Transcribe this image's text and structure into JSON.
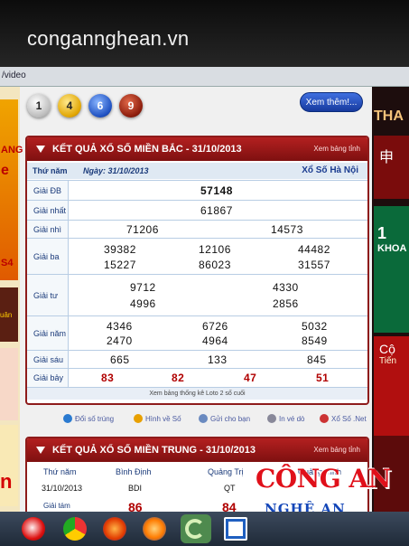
{
  "watermark": "congannghean.vn",
  "browser": {
    "tab_label": "/video"
  },
  "balls": [
    "1",
    "4",
    "6",
    "9"
  ],
  "more_button": "Xem thêm!...",
  "north": {
    "title": "KẾT QUẢ XỔ SỐ MIỀN BẮC - 31/10/2013",
    "view_by_province": "Xem bảng tỉnh",
    "col_header_thu_nam": "Thứ năm",
    "date_label": "Ngày: 31/10/2013",
    "lottery_name": "Xổ Số Hà Nội",
    "prizes": [
      {
        "label": "Giải ĐB",
        "numbers": [
          "57148"
        ]
      },
      {
        "label": "Giải nhất",
        "numbers": [
          "61867"
        ]
      },
      {
        "label": "Giải nhì",
        "numbers": [
          "71206",
          "14573"
        ]
      },
      {
        "label": "Giải ba",
        "numbers": [
          "39382",
          "12106",
          "44482",
          "15227",
          "86023",
          "31557"
        ]
      },
      {
        "label": "Giải tư",
        "numbers": [
          "9712",
          "4330",
          "4996",
          "2856"
        ]
      },
      {
        "label": "Giải năm",
        "numbers": [
          "4346",
          "6726",
          "5032",
          "2470",
          "4964",
          "8549"
        ]
      },
      {
        "label": "Giải sáu",
        "numbers": [
          "665",
          "133",
          "845"
        ]
      },
      {
        "label": "Giải bảy",
        "numbers": [
          "83",
          "82",
          "47",
          "51"
        ]
      }
    ],
    "footnote": "Xem bảng thống kê Loto 2 số cuối"
  },
  "links": [
    {
      "label": "Đổi số trúng",
      "icon": "globe-icon"
    },
    {
      "label": "Hình về Số",
      "icon": "dollar-icon"
    },
    {
      "label": "Gửi cho bạn",
      "icon": "mail-icon"
    },
    {
      "label": "In vé dò",
      "icon": "print-icon"
    },
    {
      "label": "Xổ Số .Net",
      "icon": "lottery-icon"
    }
  ],
  "central": {
    "title": "KẾT QUẢ XỔ SỐ MIỀN TRUNG - 31/10/2013",
    "view_by_province": "Xem bảng tỉnh",
    "col_header": "Thứ năm",
    "provinces": [
      "Bình Định",
      "Quảng Trị",
      "Quảng Bình"
    ],
    "date": "31/10/2013",
    "codes": [
      "BDI",
      "QT"
    ],
    "prize_label": "Giải tám",
    "prize_values": [
      "86",
      "84"
    ]
  },
  "logo": {
    "line1": "CÔNG AN",
    "line2": "NGHỆ AN"
  },
  "sidebar_right": {
    "tha": "THA",
    "khoa": "KHOA",
    "number_1": "1",
    "red_label": "Cộ",
    "red_sub": "Tiến"
  },
  "sidebar_left": {
    "lines": [
      "ANG",
      "e",
      "S4"
    ],
    "uan": "uân",
    "bottom": "n"
  },
  "colors": {
    "header_red": "#b32020",
    "link_blue": "#1a3a7a",
    "logo_red": "#e0101a",
    "logo_blue": "#1346b8"
  }
}
